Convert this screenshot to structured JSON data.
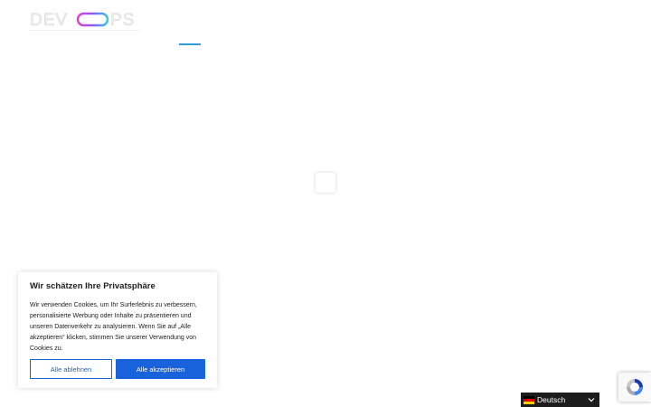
{
  "brand": {
    "logo_name": "devops-logo",
    "logo_text_left": "DEV",
    "logo_text_right": "PS"
  },
  "cookie_banner": {
    "title": "Wir schätzen Ihre Privatsphäre",
    "text": "Wir verwenden Cookies, um Ihr Surferlebnis zu verbessern, personalisierte Werbung oder Inhalte zu präsentieren und unseren Datenverkehr zu analysieren. Wenn Sie auf „Alle akzeptieren“ klicken, stimmen Sie unserer Verwendung von Cookies zu.",
    "reject_label": "Alle ablehnen",
    "accept_label": "Alle akzeptieren"
  },
  "language_switcher": {
    "selected": "Deutsch",
    "flag_icon": "germany-flag-icon"
  },
  "colors": {
    "primary": "#1863dc",
    "nav_accent": "#2d9cdb",
    "switcher_bg": "#1c1c1c",
    "text": "#212121"
  }
}
